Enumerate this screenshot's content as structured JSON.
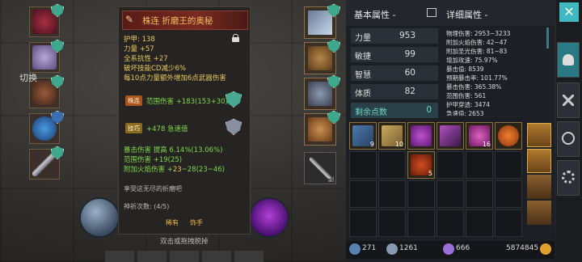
{
  "tooltip": {
    "title": "株连 折磨王的奥秘",
    "lines": [
      "护甲: 138",
      "力量 +57",
      "全系抗性 +27",
      "破坏技能CD减少6%",
      "每10点力量额外增加6点武器伤害"
    ],
    "gem1_tag": "株连",
    "gem1_text": "范围伤害 +183(153+30)",
    "gem2_tag": "技巧",
    "gem2_text": "+478 急速值",
    "bonus1": "暴击伤害 提高 6.14%(13.06%)",
    "bonus2": "范围伤害 +19(25)",
    "bonus3_a": "附加火焰伤害 +",
    "bonus3_b": "23",
    "bonus3_c": "~28(23~46)",
    "flavor": "享受这无尽的折磨吧",
    "forge_label": "神祈次数: (4/5)",
    "rarity": "稀有",
    "slot_type": "饰手"
  },
  "left": {
    "pause": "切换",
    "hint": "双击或拖拽脱掉"
  },
  "right_equip": {
    "label": "副"
  },
  "stats": {
    "basic_title": "基本属性 -",
    "detail_title": "详细属性 -",
    "attributes": [
      {
        "label": "力量",
        "value": "953"
      },
      {
        "label": "敏捷",
        "value": "99"
      },
      {
        "label": "智慧",
        "value": "60"
      },
      {
        "label": "体质",
        "value": "82"
      }
    ],
    "remaining_label": "剩余点数",
    "remaining_value": "0",
    "details": [
      "物理伤害: 2953~3233",
      "附加火焰伤害: 42~47",
      "附加圣光伤害: 81~83",
      "增加攻速: 75.97%",
      "暴击值: 8539",
      "预期暴击率: 101.77%",
      "暴击伤害: 365.38%",
      "范围伤害: 561",
      "护甲穿透: 3474",
      "急速值: 2653"
    ]
  },
  "inventory": {
    "counts": [
      "9",
      "10",
      "",
      "",
      "16",
      "",
      "5"
    ]
  },
  "currency": {
    "c1": "271",
    "c2": "1261",
    "c3": "666",
    "gold": "5874845"
  },
  "colors": {
    "accent": "#3fb8c0",
    "highlight_stat": "#6fd8c0",
    "green_text": "#7ed84a",
    "title_gold": "#f0c060"
  }
}
